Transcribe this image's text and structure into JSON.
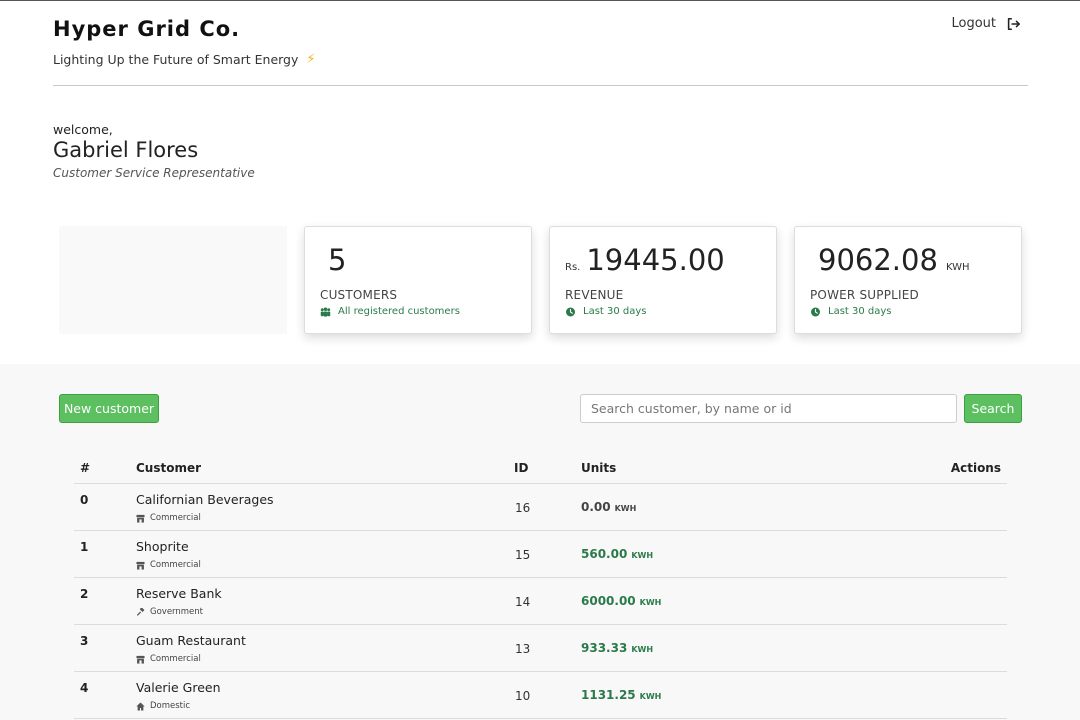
{
  "header": {
    "brand": "Hyper Grid Co.",
    "tagline": "Lighting Up the Future of Smart Energy",
    "tagline_icon": "lightning-bolt-icon",
    "logout_label": "Logout"
  },
  "user": {
    "greeting": "welcome,",
    "name": "Gabriel Flores",
    "role": "Customer Service Representative"
  },
  "stats": [
    {
      "value": "5",
      "prefix": "",
      "suffix": "",
      "label": "CUSTOMERS",
      "sub": "All registered customers",
      "sub_icon": "users-icon"
    },
    {
      "value": "19445.00",
      "prefix": "Rs.",
      "suffix": "",
      "label": "REVENUE",
      "sub": "Last 30 days",
      "sub_icon": "clock-icon"
    },
    {
      "value": "9062.08",
      "prefix": "",
      "suffix": "KWH",
      "label": "POWER SUPPLIED",
      "sub": "Last 30 days",
      "sub_icon": "clock-icon"
    }
  ],
  "toolbar": {
    "new_customer_label": "New customer",
    "search_placeholder": "Search customer, by name or id",
    "search_label": "Search"
  },
  "table": {
    "columns": [
      "#",
      "Customer",
      "ID",
      "Units",
      "Actions"
    ],
    "rows": [
      {
        "index": "0",
        "name": "Californian Beverages",
        "type": "Commercial",
        "type_icon": "store-icon",
        "id": "16",
        "units": "0.00",
        "unit": "KWH"
      },
      {
        "index": "1",
        "name": "Shoprite",
        "type": "Commercial",
        "type_icon": "store-icon",
        "id": "15",
        "units": "560.00",
        "unit": "KWH"
      },
      {
        "index": "2",
        "name": "Reserve Bank",
        "type": "Government",
        "type_icon": "gavel-icon",
        "id": "14",
        "units": "6000.00",
        "unit": "KWH"
      },
      {
        "index": "3",
        "name": "Guam Restaurant",
        "type": "Commercial",
        "type_icon": "store-icon",
        "id": "13",
        "units": "933.33",
        "unit": "KWH"
      },
      {
        "index": "4",
        "name": "Valerie Green",
        "type": "Domestic",
        "type_icon": "home-icon",
        "id": "10",
        "units": "1131.25",
        "unit": "KWH"
      }
    ]
  },
  "colors": {
    "accent_green": "#5cbf60",
    "text_green": "#2a7a4a",
    "bolt_yellow": "#f2b01e"
  }
}
